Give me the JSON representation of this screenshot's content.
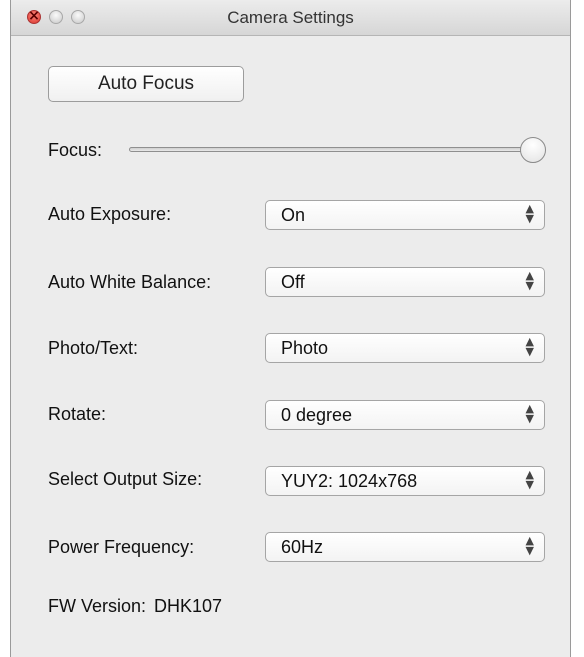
{
  "window": {
    "title": "Camera Settings"
  },
  "auto_focus_label": "Auto Focus",
  "focus": {
    "label": "Focus:",
    "level_fraction": 1.0
  },
  "settings": [
    {
      "label": "Auto Exposure:",
      "value": "On"
    },
    {
      "label": "Auto White Balance:",
      "value": "Off"
    },
    {
      "label": "Photo/Text:",
      "value": "Photo"
    },
    {
      "label": "Rotate:",
      "value": "0 degree"
    },
    {
      "label": "Select Output Size:",
      "value": "YUY2: 1024x768"
    },
    {
      "label": "Power Frequency:",
      "value": "60Hz"
    }
  ],
  "fw": {
    "label": "FW Version:",
    "value": "DHK107"
  },
  "icons": {
    "popup_arrows": "up-down-chevron-icon",
    "close": "close-icon"
  }
}
